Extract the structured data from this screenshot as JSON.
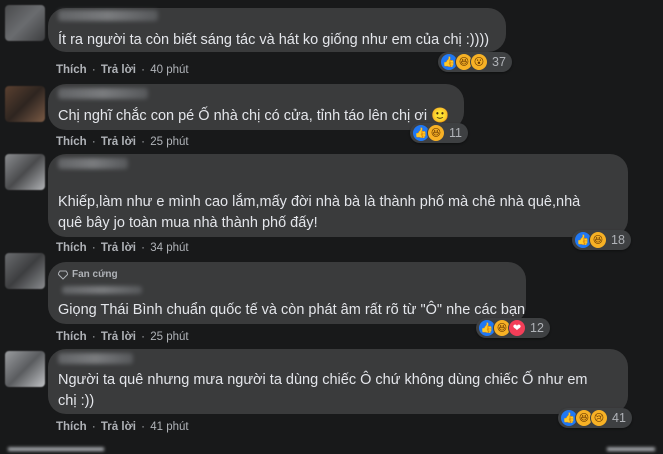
{
  "actions": {
    "like_label": "Thích",
    "reply_label": "Trả lời",
    "separator": "·"
  },
  "badge": {
    "fan_label": "Fan cứng"
  },
  "comments": [
    {
      "lines": [
        "Ít ra người ta còn biết sáng tác và hát ko giống như em của chị :))))"
      ],
      "time": "40 phút",
      "reaction_count": "37",
      "reactions": [
        "like-icon",
        "haha-icon"
      ]
    },
    {
      "lines": [
        "Chị nghĩ chắc con pé Ố nhà chị có cửa, tỉnh táo lên chị ơi 🙂"
      ],
      "time": "25 phút",
      "reaction_count": "11",
      "reactions": [
        "like-icon",
        "haha-icon"
      ]
    },
    {
      "lines": [
        "Khiếp,làm như e mình cao lắm,mấy đời nhà bà là thành phố mà chê nhà quê,nhà",
        "quê bây jo toàn mua nhà thành phố đấy!"
      ],
      "time": "34 phút",
      "reaction_count": "18",
      "reactions": [
        "like-icon",
        "haha-icon"
      ]
    },
    {
      "lines": [
        "Giọng Thái Bình chuẩn quốc tế và còn phát âm rất rõ từ \"Ô\" nhe các bạn"
      ],
      "time": "25 phút",
      "reaction_count": "12",
      "reactions": [
        "like-icon",
        "haha-icon",
        "love-icon"
      ]
    },
    {
      "lines": [
        "Người ta quê nhưng mưa người ta dùng chiếc Ô chứ không dùng chiếc Ố như em",
        "chị :))"
      ],
      "time": "41 phút",
      "reaction_count": "41",
      "reactions": [
        "like-icon",
        "haha-icon",
        "sad-icon"
      ]
    }
  ],
  "colors": {
    "background": "#18191a",
    "bubble": "#3a3b3c",
    "text": "#e4e6eb",
    "muted": "#b0b3b8",
    "like": "#2078f4",
    "haha": "#f7b125",
    "love": "#f33e58"
  }
}
